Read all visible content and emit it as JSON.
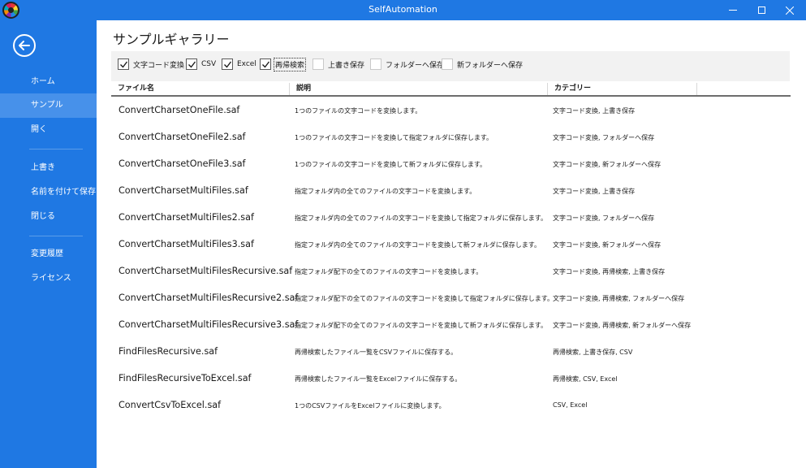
{
  "window": {
    "title": "SelfAutomation"
  },
  "sidebar": {
    "items": [
      {
        "label": "ホーム",
        "active": false
      },
      {
        "label": "サンプル",
        "active": true
      },
      {
        "label": "開く",
        "active": false
      },
      {
        "label": "上書き",
        "active": false
      },
      {
        "label": "名前を付けて保存",
        "active": false
      },
      {
        "label": "閉じる",
        "active": false
      },
      {
        "label": "変更履歴",
        "active": false
      },
      {
        "label": "ライセンス",
        "active": false
      }
    ]
  },
  "page": {
    "title": "サンプルギャラリー"
  },
  "filters": [
    {
      "label": "文字コード変換",
      "checked": true
    },
    {
      "label": "CSV",
      "checked": true
    },
    {
      "label": "Excel",
      "checked": true
    },
    {
      "label": "再帰検索",
      "checked": true
    },
    {
      "label": "上書き保存",
      "checked": false
    },
    {
      "label": "フォルダーへ保存",
      "checked": false
    },
    {
      "label": "新フォルダーへ保存",
      "checked": false
    }
  ],
  "table": {
    "columns": [
      "ファイル名",
      "説明",
      "カテゴリー"
    ],
    "rows": [
      {
        "file": "ConvertCharsetOneFile.saf",
        "desc": "1つのファイルの文字コードを変換します。",
        "category": "文字コード変換, 上書き保存"
      },
      {
        "file": "ConvertCharsetOneFile2.saf",
        "desc": "1つのファイルの文字コードを変換して指定フォルダに保存します。",
        "category": "文字コード変換, フォルダーへ保存"
      },
      {
        "file": "ConvertCharsetOneFile3.saf",
        "desc": "1つのファイルの文字コードを変換して新フォルダに保存します。",
        "category": "文字コード変換, 新フォルダーへ保存"
      },
      {
        "file": "ConvertCharsetMultiFiles.saf",
        "desc": "指定フォルダ内の全てのファイルの文字コードを変換します。",
        "category": "文字コード変換, 上書き保存"
      },
      {
        "file": "ConvertCharsetMultiFiles2.saf",
        "desc": "指定フォルダ内の全てのファイルの文字コードを変換して指定フォルダに保存します。",
        "category": "文字コード変換, フォルダーへ保存"
      },
      {
        "file": "ConvertCharsetMultiFiles3.saf",
        "desc": "指定フォルダ内の全てのファイルの文字コードを変換して新フォルダに保存します。",
        "category": "文字コード変換, 新フォルダーへ保存"
      },
      {
        "file": "ConvertCharsetMultiFilesRecursive.saf",
        "desc": "指定フォルダ配下の全てのファイルの文字コードを変換します。",
        "category": "文字コード変換, 再帰検索, 上書き保存"
      },
      {
        "file": "ConvertCharsetMultiFilesRecursive2.saf",
        "desc": "指定フォルダ配下の全てのファイルの文字コードを変換して指定フォルダに保存します。",
        "category": "文字コード変換, 再帰検索, フォルダーへ保存"
      },
      {
        "file": "ConvertCharsetMultiFilesRecursive3.saf",
        "desc": "指定フォルダ配下の全てのファイルの文字コードを変換して新フォルダに保存します。",
        "category": "文字コード変換, 再帰検索, 新フォルダーへ保存"
      },
      {
        "file": "FindFilesRecursive.saf",
        "desc": "再帰検索したファイル一覧をCSVファイルに保存する。",
        "category": "再帰検索, 上書き保存, CSV"
      },
      {
        "file": "FindFilesRecursiveToExcel.saf",
        "desc": "再帰検索したファイル一覧をExcelファイルに保存する。",
        "category": "再帰検索, CSV, Excel"
      },
      {
        "file": "ConvertCsvToExcel.saf",
        "desc": "1つのCSVファイルをExcelファイルに変換します。",
        "category": "CSV, Excel"
      }
    ]
  }
}
